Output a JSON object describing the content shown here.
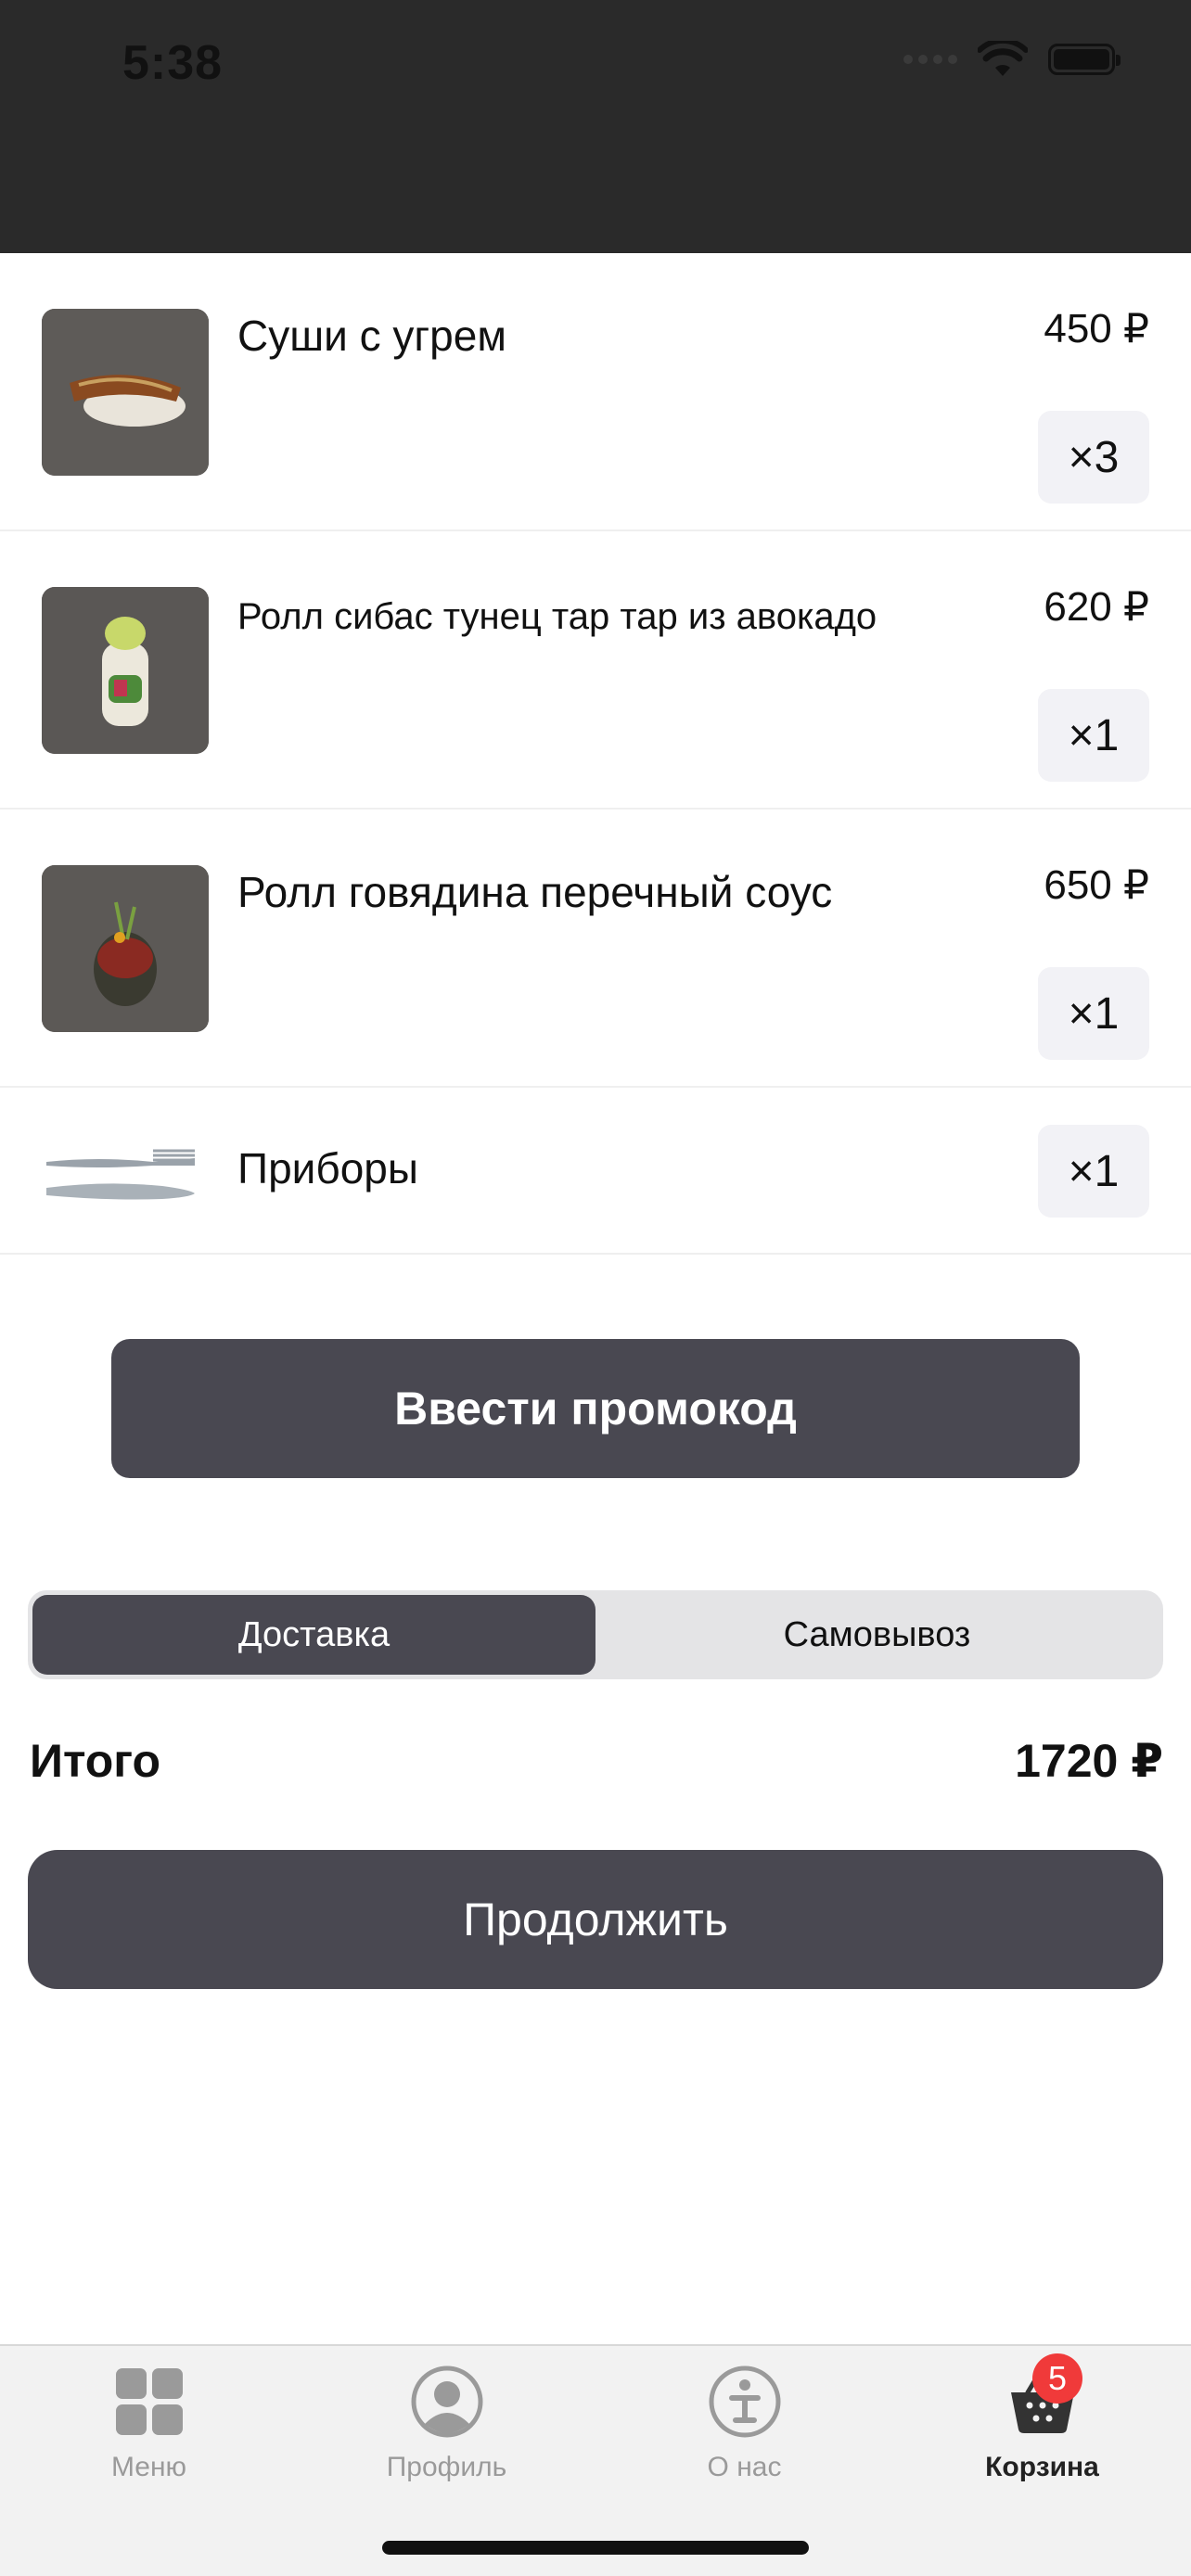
{
  "status": {
    "time": "5:38"
  },
  "cart": {
    "items": [
      {
        "name": "Суши с угрем",
        "price": "450 ₽",
        "qty": "×3",
        "image": "sushi-eel-image"
      },
      {
        "name": "Ролл сибас тунец тар тар из авокадо",
        "price": "620 ₽",
        "qty": "×1",
        "image": "roll-seabass-image"
      },
      {
        "name": "Ролл говядина перечный соус",
        "price": "650 ₽",
        "qty": "×1",
        "image": "roll-beef-image"
      },
      {
        "name": "Приборы",
        "qty": "×1",
        "image": "cutlery-image"
      }
    ]
  },
  "promo": {
    "label": "Ввести промокод"
  },
  "delivery": {
    "options": [
      "Доставка",
      "Самовывоз"
    ],
    "selected": "Доставка"
  },
  "total": {
    "label": "Итого",
    "value": "1720 ₽"
  },
  "continue": {
    "label": "Продолжить"
  },
  "tabbar": {
    "tabs": [
      {
        "label": "Меню",
        "icon": "grid-icon"
      },
      {
        "label": "Профиль",
        "icon": "person-icon"
      },
      {
        "label": "О нас",
        "icon": "info-icon"
      },
      {
        "label": "Корзина",
        "icon": "basket-icon",
        "badge": "5",
        "active": true
      }
    ]
  },
  "colors": {
    "dark_button": "#494851",
    "badge": "#f03a3a",
    "header": "#2a2a2a"
  }
}
